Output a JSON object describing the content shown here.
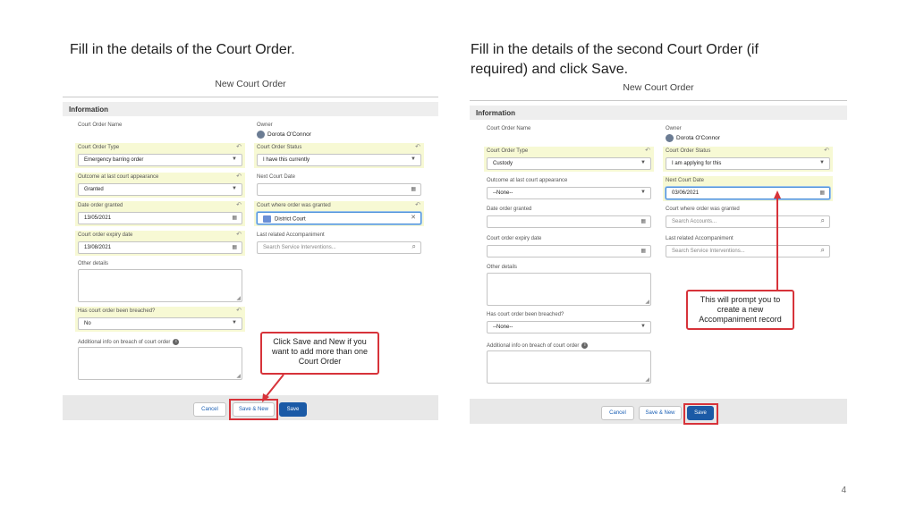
{
  "left": {
    "heading": "Fill in the details of the Court Order.",
    "title": "New Court Order",
    "section": "Information",
    "labels": {
      "court_order_name": "Court Order Name",
      "owner": "Owner",
      "court_order_type": "Court Order Type",
      "court_order_status": "Court Order Status",
      "outcome": "Outcome at last court appearance",
      "next_court_date": "Next Court Date",
      "date_granted": "Date order granted",
      "court_where": "Court where order was granted",
      "expiry": "Court order expiry date",
      "last_accompaniment": "Last related Accompaniment",
      "other_details": "Other details",
      "breached": "Has court order been breached?",
      "additional_info": "Additional info on breach of court order"
    },
    "values": {
      "owner": "Dorota O'Connor",
      "court_order_type": "Emergency barring order",
      "court_order_status": "I have this currently",
      "outcome": "Granted",
      "date_granted": "13/05/2021",
      "court_where": "District Court",
      "expiry": "13/08/2021",
      "breached": "No"
    },
    "placeholders": {
      "last_accompaniment": "Search Service Interventions..."
    },
    "buttons": {
      "cancel": "Cancel",
      "save_new": "Save & New",
      "save": "Save"
    },
    "callout": "Click Save and New if you want to add more than one Court Order"
  },
  "right": {
    "heading": "Fill in the details of the second Court Order (if required) and click Save.",
    "title": "New Court Order",
    "section": "Information",
    "labels": {
      "court_order_name": "Court Order Name",
      "owner": "Owner",
      "court_order_type": "Court Order Type",
      "court_order_status": "Court Order Status",
      "outcome": "Outcome at last court appearance",
      "next_court_date": "Next Court Date",
      "date_granted": "Date order granted",
      "court_where": "Court where order was granted",
      "expiry": "Court order expiry date",
      "last_accompaniment": "Last related Accompaniment",
      "other_details": "Other details",
      "breached": "Has court order been breached?",
      "additional_info": "Additional info on breach of court order"
    },
    "values": {
      "owner": "Dorota O'Connor",
      "court_order_type": "Custody",
      "court_order_status": "I am applying for this",
      "outcome": "--None--",
      "next_court_date": "03/06/2021",
      "breached": "--None--"
    },
    "placeholders": {
      "court_where": "Search Accounts...",
      "last_accompaniment": "Search Service Interventions..."
    },
    "buttons": {
      "cancel": "Cancel",
      "save_new": "Save & New",
      "save": "Save"
    },
    "callout": "This will prompt you to create a new Accompaniment record"
  },
  "page_number": "4"
}
